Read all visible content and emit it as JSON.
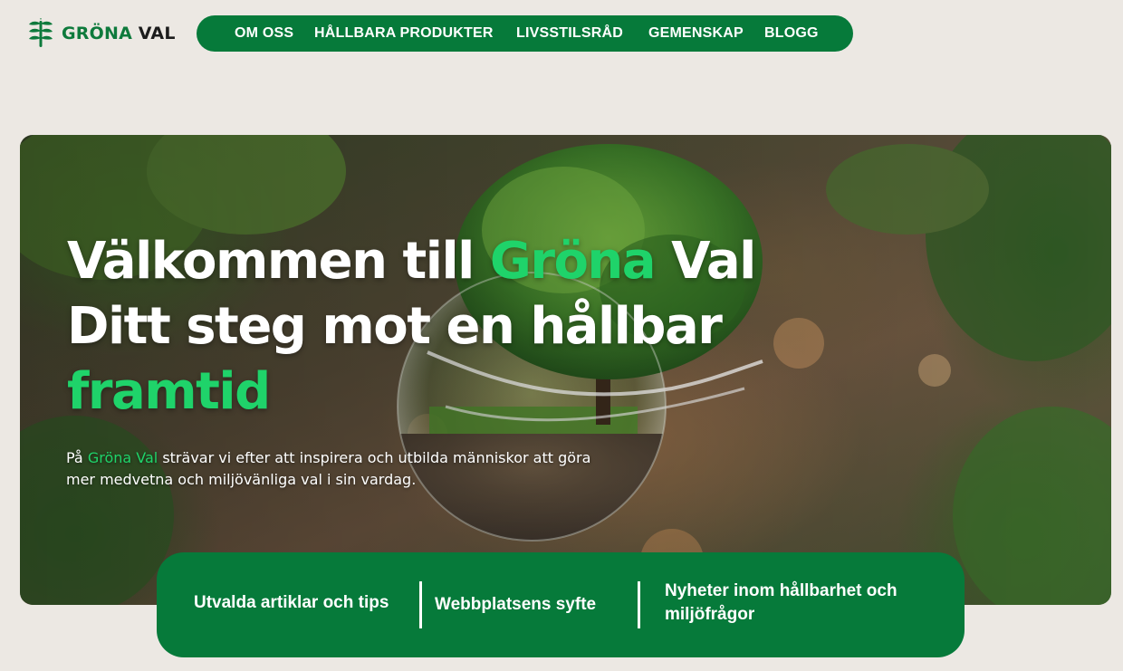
{
  "brand": {
    "name_green": "GRÖNA",
    "name_dark": " VAL",
    "icon": "leaf-sprout-icon",
    "color": "#0e7a3c"
  },
  "nav": {
    "items": [
      {
        "label": "OM OSS"
      },
      {
        "label": "HÅLLBARA PRODUKTER"
      },
      {
        "label": "LIVSSTILSRÅD"
      },
      {
        "label": "GEMENSKAP"
      },
      {
        "label": "BLOGG"
      }
    ],
    "background": "#067a3a"
  },
  "hero": {
    "title_part1": "Välkommen till ",
    "title_accent1": "Gröna",
    "title_part2": " Val",
    "title_line2": "Ditt steg mot en hållbar",
    "title_accent2": "framtid",
    "subtitle_part1": "På ",
    "subtitle_accent": "Gröna Val",
    "subtitle_part2": " strävar vi efter att inspirera och utbilda människor att göra mer medvetna och miljövänliga val i sin vardag.",
    "accent_color": "#1fd36a"
  },
  "features": [
    {
      "label": "Utvalda artiklar och tips"
    },
    {
      "label": "Webbplatsens syfte"
    },
    {
      "label": "Nyheter inom hållbarhet och miljöfrågor"
    }
  ]
}
